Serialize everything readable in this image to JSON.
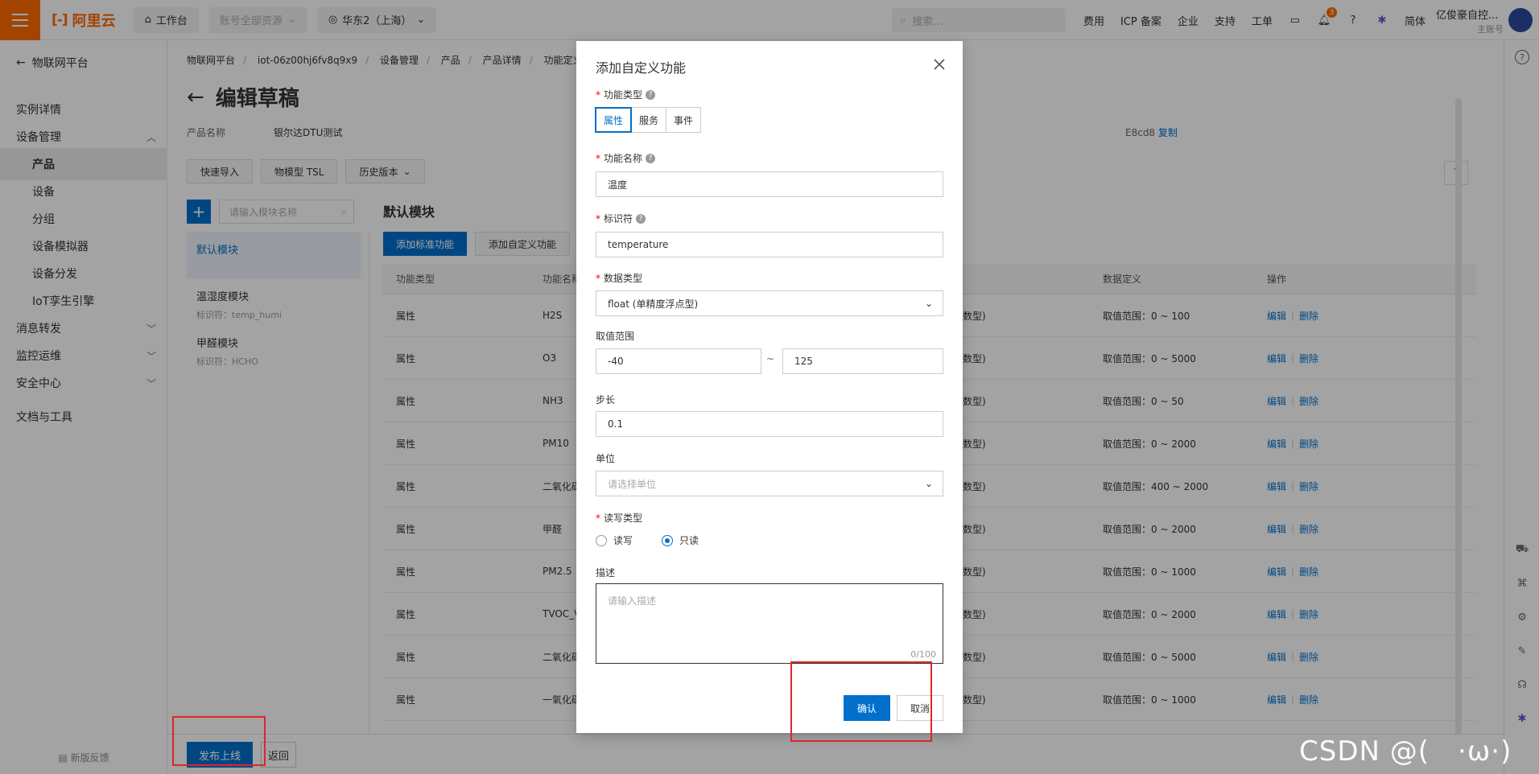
{
  "topbar": {
    "brand": "阿里云",
    "workbench": "工作台",
    "account_scope": "账号全部资源",
    "region": "华东2（上海）",
    "search_placeholder": "搜索...",
    "links": [
      "费用",
      "ICP 备案",
      "企业",
      "支持",
      "工单"
    ],
    "notif_count": "3",
    "lang": "简体",
    "user_name": "亿俊豪自控...",
    "user_role": "主账号"
  },
  "sidebar": {
    "back_label": "物联网平台",
    "items": [
      {
        "label": "实例详情"
      },
      {
        "label": "设备管理"
      },
      {
        "label": "产品"
      },
      {
        "label": "设备"
      },
      {
        "label": "分组"
      },
      {
        "label": "设备模拟器"
      },
      {
        "label": "设备分发"
      },
      {
        "label": "IoT孪生引擎"
      },
      {
        "label": "消息转发"
      },
      {
        "label": "监控运维"
      },
      {
        "label": "安全中心"
      },
      {
        "label": "文档与工具"
      }
    ],
    "feedback": "新版反馈"
  },
  "main": {
    "breadcrumb": [
      "物联网平台",
      "iot-06z00hj6fv8q9x9",
      "设备管理",
      "产品",
      "产品详情",
      "功能定义"
    ],
    "title": "编辑草稿",
    "product_label": "产品名称",
    "product_name": "银尔达DTU测试",
    "product_key_tail": "E8cd8",
    "copy": "复制",
    "buttons": {
      "quick_import": "快速导入",
      "tsl": "物模型 TSL",
      "history": "历史版本"
    },
    "module_search_placeholder": "请输入模块名称",
    "modules": [
      {
        "name": "默认模块",
        "id": ""
      },
      {
        "name": "温湿度模块",
        "id": "标识符：temp_humi"
      },
      {
        "name": "甲醛模块",
        "id": "标识符：HCHO"
      }
    ],
    "module_title": "默认模块",
    "add_std": "添加标准功能",
    "add_custom": "添加自定义功能",
    "table": {
      "headers": [
        "功能类型",
        "功能名称",
        "",
        "数据定义",
        "操作"
      ],
      "rows": [
        {
          "type": "属性",
          "name": "H2S",
          "dtype": "数型)",
          "def": "取值范围：0 ~ 100"
        },
        {
          "type": "属性",
          "name": "O3",
          "dtype": "数型)",
          "def": "取值范围：0 ~ 5000"
        },
        {
          "type": "属性",
          "name": "NH3",
          "dtype": "数型)",
          "def": "取值范围：0 ~ 50"
        },
        {
          "type": "属性",
          "name": "PM10",
          "dtype": "数型)",
          "def": "取值范围：0 ~ 2000"
        },
        {
          "type": "属性",
          "name": "二氧化碳",
          "dtype": "数型)",
          "def": "取值范围：400 ~ 2000"
        },
        {
          "type": "属性",
          "name": "甲醛",
          "dtype": "数型)",
          "def": "取值范围：0 ~ 2000"
        },
        {
          "type": "属性",
          "name": "PM2.5",
          "dtype": "数型)",
          "def": "取值范围：0 ~ 1000"
        },
        {
          "type": "属性",
          "name": "TVOC_V",
          "dtype": "数型)",
          "def": "取值范围：0 ~ 2000"
        },
        {
          "type": "属性",
          "name": "二氧化碳",
          "dtype": "数型)",
          "def": "取值范围：0 ~ 5000"
        },
        {
          "type": "属性",
          "name": "一氧化碳",
          "dtype": "数型)",
          "def": "取值范围：0 ~ 1000"
        }
      ],
      "edit": "编辑",
      "delete": "删除"
    }
  },
  "footer": {
    "publish": "发布上线",
    "back": "返回"
  },
  "modal": {
    "title": "添加自定义功能",
    "func_type_label": "功能类型",
    "func_types": [
      "属性",
      "服务",
      "事件"
    ],
    "name_label": "功能名称",
    "name_value": "温度",
    "id_label": "标识符",
    "id_value": "temperature",
    "dtype_label": "数据类型",
    "dtype_value": "float (单精度浮点型)",
    "range_label": "取值范围",
    "range_min": "-40",
    "range_max": "125",
    "range_sep": "~",
    "step_label": "步长",
    "step_value": "0.1",
    "unit_label": "单位",
    "unit_placeholder": "请选择单位",
    "rw_label": "读写类型",
    "rw_options": [
      "读写",
      "只读"
    ],
    "desc_label": "描述",
    "desc_placeholder": "请输入描述",
    "desc_count": "0/100",
    "ok": "确认",
    "cancel": "取消"
  },
  "watermark": "CSDN @(　·ω·)"
}
